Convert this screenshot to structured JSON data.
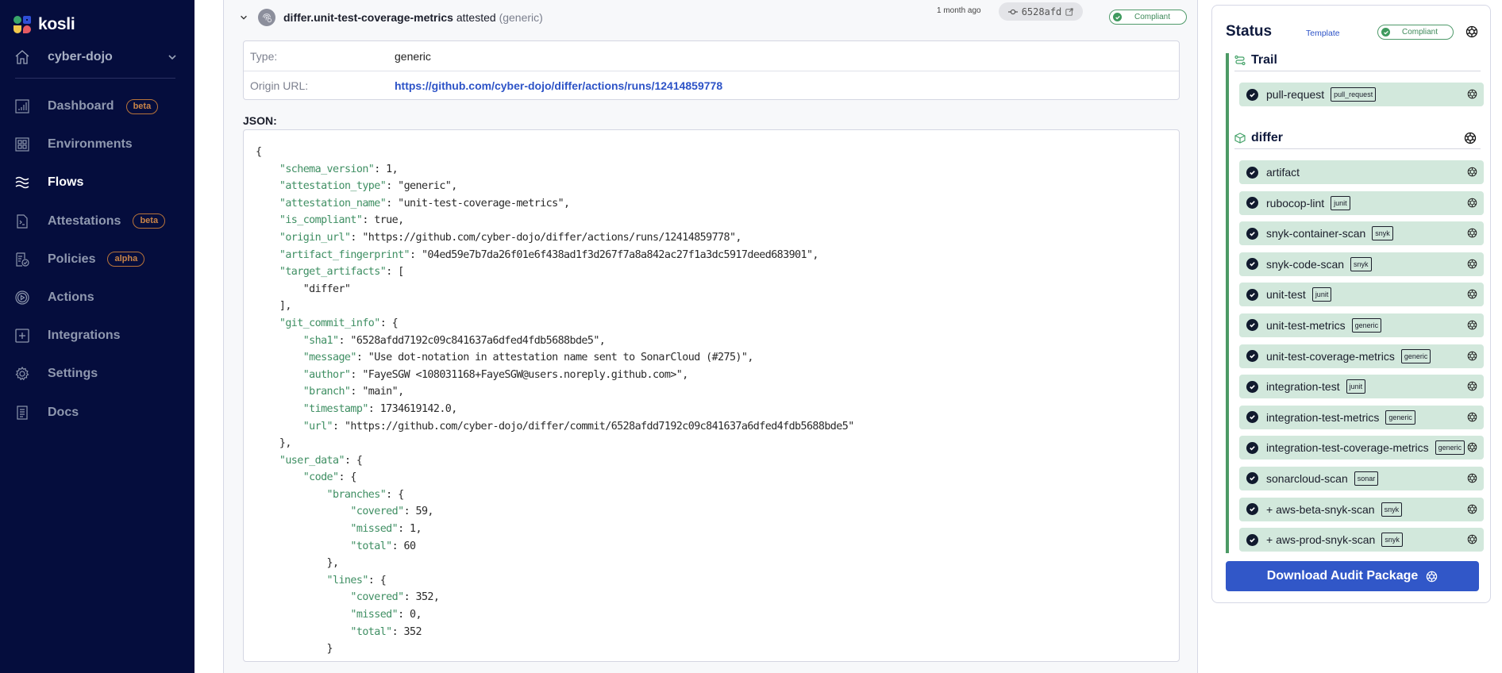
{
  "brand": {
    "name": "kosli"
  },
  "sidebar": {
    "org": "cyber-dojo",
    "items": [
      {
        "label": "Dashboard",
        "icon": "chart-icon",
        "badge": "beta",
        "active": false
      },
      {
        "label": "Environments",
        "icon": "grid-icon",
        "badge": null,
        "active": false
      },
      {
        "label": "Flows",
        "icon": "waves-icon",
        "badge": null,
        "active": true
      },
      {
        "label": "Attestations",
        "icon": "terminal-file-icon",
        "badge": "beta",
        "active": false
      },
      {
        "label": "Policies",
        "icon": "policy-check-icon",
        "badge": "alpha",
        "active": false
      },
      {
        "label": "Actions",
        "icon": "play-circle-icon",
        "badge": null,
        "active": false
      },
      {
        "label": "Integrations",
        "icon": "plus-square-icon",
        "badge": null,
        "active": false
      },
      {
        "label": "Settings",
        "icon": "gear-icon",
        "badge": null,
        "active": false
      },
      {
        "label": "Docs",
        "icon": "document-icon",
        "badge": null,
        "active": false
      }
    ]
  },
  "attestation": {
    "name": "differ.unit-test-coverage-metrics",
    "verb": "attested",
    "type_paren": "(generic)",
    "time_ago": "1 month ago",
    "commit_short": "6528afd",
    "status": "Compliant",
    "info": {
      "type_label": "Type:",
      "type_value": "generic",
      "origin_label": "Origin URL:",
      "origin_value": "https://github.com/cyber-dojo/differ/actions/runs/12414859778"
    },
    "json_label": "JSON:",
    "json_lines": [
      {
        "indent": 0,
        "key": null,
        "text": "{"
      },
      {
        "indent": 1,
        "key": "schema_version",
        "text": " 1,"
      },
      {
        "indent": 1,
        "key": "attestation_type",
        "text": " \"generic\","
      },
      {
        "indent": 1,
        "key": "attestation_name",
        "text": " \"unit-test-coverage-metrics\","
      },
      {
        "indent": 1,
        "key": "is_compliant",
        "text": " true,"
      },
      {
        "indent": 1,
        "key": "origin_url",
        "text": " \"https://github.com/cyber-dojo/differ/actions/runs/12414859778\","
      },
      {
        "indent": 1,
        "key": "artifact_fingerprint",
        "text": " \"04ed59e7b7da26f01e6f438ad1f3d267f7a8a842ac27f1a3dc5917deed683901\","
      },
      {
        "indent": 1,
        "key": "target_artifacts",
        "text": " ["
      },
      {
        "indent": 2,
        "key": null,
        "text": "\"differ\""
      },
      {
        "indent": 1,
        "key": null,
        "text": "],"
      },
      {
        "indent": 1,
        "key": "git_commit_info",
        "text": " {"
      },
      {
        "indent": 2,
        "key": "sha1",
        "text": " \"6528afdd7192c09c841637a6dfed4fdb5688bde5\","
      },
      {
        "indent": 2,
        "key": "message",
        "text": " \"Use dot-notation in attestation name sent to SonarCloud (#275)\","
      },
      {
        "indent": 2,
        "key": "author",
        "text": " \"FayeSGW <108031168+FayeSGW@users.noreply.github.com>\","
      },
      {
        "indent": 2,
        "key": "branch",
        "text": " \"main\","
      },
      {
        "indent": 2,
        "key": "timestamp",
        "text": " 1734619142.0,"
      },
      {
        "indent": 2,
        "key": "url",
        "text": " \"https://github.com/cyber-dojo/differ/commit/6528afdd7192c09c841637a6dfed4fdb5688bde5\""
      },
      {
        "indent": 1,
        "key": null,
        "text": "},"
      },
      {
        "indent": 1,
        "key": "user_data",
        "text": " {"
      },
      {
        "indent": 2,
        "key": "code",
        "text": " {"
      },
      {
        "indent": 3,
        "key": "branches",
        "text": " {"
      },
      {
        "indent": 4,
        "key": "covered",
        "text": " 59,"
      },
      {
        "indent": 4,
        "key": "missed",
        "text": " 1,"
      },
      {
        "indent": 4,
        "key": "total",
        "text": " 60"
      },
      {
        "indent": 3,
        "key": null,
        "text": "},"
      },
      {
        "indent": 3,
        "key": "lines",
        "text": " {"
      },
      {
        "indent": 4,
        "key": "covered",
        "text": " 352,"
      },
      {
        "indent": 4,
        "key": "missed",
        "text": " 0,"
      },
      {
        "indent": 4,
        "key": "total",
        "text": " 352"
      },
      {
        "indent": 3,
        "key": null,
        "text": "}"
      },
      {
        "indent": 2,
        "key": null,
        "text": "}"
      }
    ]
  },
  "status_panel": {
    "title": "Status",
    "template_link": "Template",
    "status": "Compliant",
    "trail": {
      "title": "Trail",
      "attestations": [
        {
          "name": "pull-request",
          "tag": "pull_request"
        }
      ]
    },
    "artifact": {
      "title": "differ",
      "attestations": [
        {
          "name": "artifact",
          "tag": null
        },
        {
          "name": "rubocop-lint",
          "tag": "junit"
        },
        {
          "name": "snyk-container-scan",
          "tag": "snyk"
        },
        {
          "name": "snyk-code-scan",
          "tag": "snyk"
        },
        {
          "name": "unit-test",
          "tag": "junit"
        },
        {
          "name": "unit-test-metrics",
          "tag": "generic"
        },
        {
          "name": "unit-test-coverage-metrics",
          "tag": "generic"
        },
        {
          "name": "integration-test",
          "tag": "junit"
        },
        {
          "name": "integration-test-metrics",
          "tag": "generic"
        },
        {
          "name": "integration-test-coverage-metrics",
          "tag": "generic"
        },
        {
          "name": "sonarcloud-scan",
          "tag": "sonar"
        },
        {
          "name": "+ aws-beta-snyk-scan",
          "tag": "snyk"
        },
        {
          "name": "+ aws-prod-snyk-scan",
          "tag": "snyk"
        }
      ]
    },
    "download_label": "Download Audit Package"
  },
  "colors": {
    "sidebar_bg": "#050d3d",
    "accent_blue": "#3157c8",
    "compliant_green": "#3f9a5e",
    "attestation_row_bg": "#d2e8dc",
    "badge_orange": "#c98448",
    "json_key": "#3f8f63"
  }
}
